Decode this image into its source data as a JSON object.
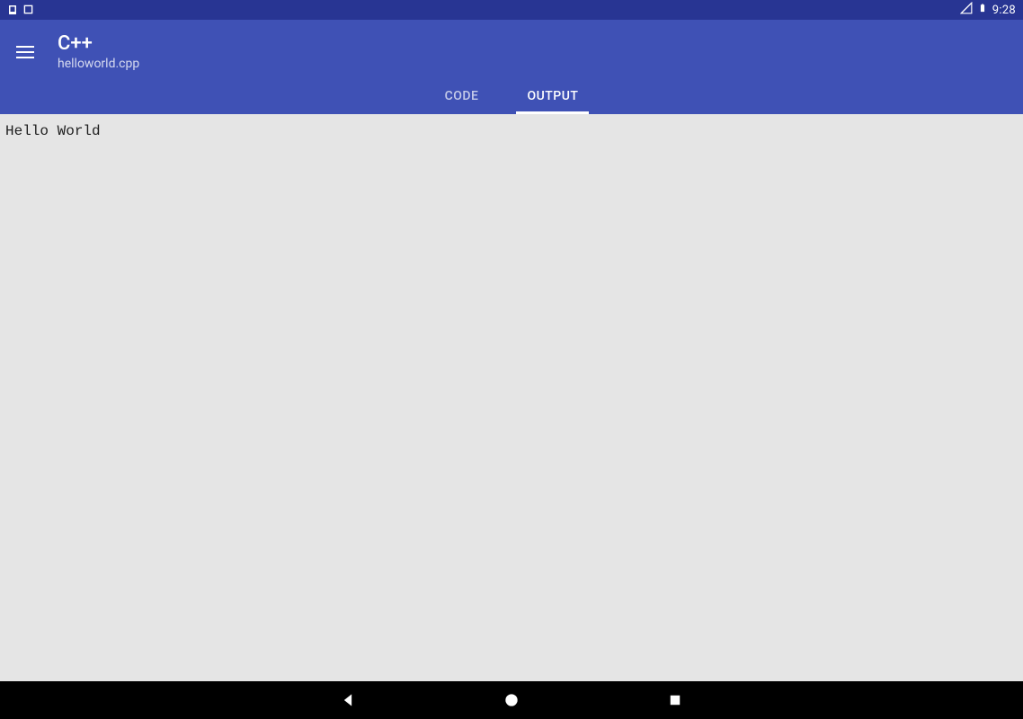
{
  "statusbar": {
    "time": "9:28"
  },
  "appbar": {
    "title": "C++",
    "subtitle": "helloworld.cpp"
  },
  "tabs": {
    "code": "CODE",
    "output": "OUTPUT",
    "active": "output"
  },
  "output": {
    "text": "Hello World"
  }
}
